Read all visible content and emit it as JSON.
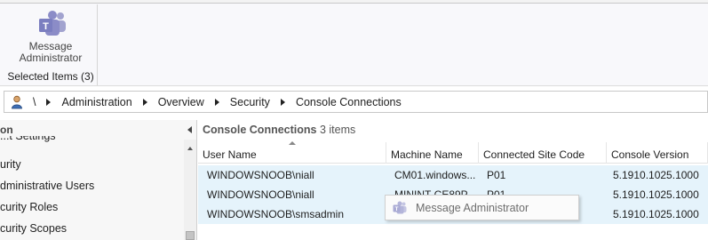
{
  "ribbon": {
    "button": {
      "icon": "teams-icon",
      "label_line1": "Message",
      "label_line2": "Administrator"
    },
    "group_caption": "Selected Items (3)"
  },
  "breadcrumb": {
    "user_icon": "user-icon",
    "items": [
      "\\",
      "Administration",
      "Overview",
      "Security",
      "Console Connections"
    ]
  },
  "nav": {
    "header": "on",
    "items": [
      "...t Settings",
      "urity",
      "dministrative Users",
      "curity Roles",
      "curity Scopes"
    ]
  },
  "main": {
    "title": "Console Connections",
    "count": "3 items",
    "columns": [
      "User Name",
      "Machine Name",
      "Connected Site Code",
      "Console Version"
    ],
    "rows": [
      {
        "user": "WINDOWSNOOB\\niall",
        "machine": "CM01.windows...",
        "site": "P01",
        "version": "5.1910.1025.1000"
      },
      {
        "user": "WINDOWSNOOB\\niall",
        "machine": "MININT-CE89P...",
        "site": "P01",
        "version": "5.1910.1025.1000"
      },
      {
        "user": "WINDOWSNOOB\\smsadmin",
        "machine": "",
        "site": "",
        "version": "5.1910.1025.1000"
      }
    ]
  },
  "popup": {
    "icon": "teams-icon",
    "label": "Message Administrator"
  },
  "colors": {
    "selection": "#e5f3fb",
    "teams_purple": "#6264a7"
  }
}
